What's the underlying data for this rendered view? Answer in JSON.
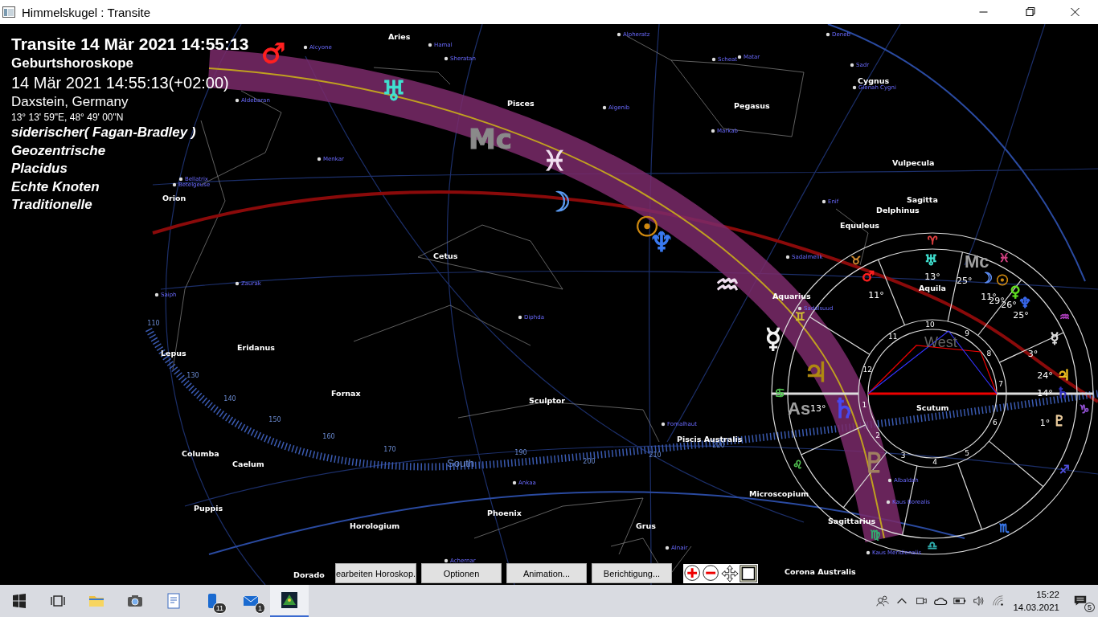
{
  "window": {
    "title": "Himmelskugel : Transite"
  },
  "info": [
    {
      "kind": "title",
      "text": "Transite 14 Mär 2021 14:55:13"
    },
    {
      "kind": "subtitle",
      "text": "Geburtshoroskope"
    },
    {
      "kind": "date",
      "text": "14 Mär 2021 14:55:13(+02:00)"
    },
    {
      "kind": "place",
      "text": "Daxstein, Germany"
    },
    {
      "kind": "coords",
      "text": "13° 13' 59\"E, 48° 49' 00\"N"
    },
    {
      "kind": "setting",
      "text": "siderischer( Fagan-Bradley )"
    },
    {
      "kind": "setting",
      "text": "Geozentrische"
    },
    {
      "kind": "setting",
      "text": "Placidus"
    },
    {
      "kind": "setting",
      "text": "Echte Knoten"
    },
    {
      "kind": "setting",
      "text": "Traditionelle"
    }
  ],
  "sky": {
    "constellations": [
      "Aries",
      "Pisces",
      "Pegasus",
      "Cygnus",
      "Vulpecula",
      "Sagitta",
      "Delphinus",
      "Equuleus",
      "Orion",
      "Cetus",
      "Aquarius",
      "Aquila",
      "Lepus",
      "Eridanus",
      "Fornax",
      "Sculptor",
      "Scutum",
      "Piscis Australis",
      "Columba",
      "Caelum",
      "Puppis",
      "Microscopium",
      "Sagittarius",
      "Phoenix",
      "Horologium",
      "Grus",
      "Dorado",
      "Corona Australis"
    ],
    "stars": [
      "Alcyone",
      "Hamal",
      "Sheratan",
      "Alpheratz",
      "Scheat",
      "Matar",
      "Deneb",
      "Sadr",
      "Gienah Cygni",
      "Aldebaran",
      "Algenib",
      "Markab",
      "Menkar",
      "Bellatrix",
      "Betelgeuse",
      "Enif",
      "Sadalmelik",
      "Zaurak",
      "Saiph",
      "Diphda",
      "Fomalhaut",
      "Ankaa",
      "Achernar",
      "Alnair",
      "Sadalsuud",
      "Albaldah",
      "Kaus Borealis",
      "Kaus Meridionalis"
    ],
    "ticks": [
      "110",
      "130",
      "140",
      "150",
      "160",
      "170",
      "190",
      "200",
      "210",
      "220"
    ],
    "direction": "South",
    "bodies": [
      {
        "glyph": "♂",
        "color": "#ff2020"
      },
      {
        "glyph": "♅",
        "color": "#40e0d0"
      },
      {
        "glyph": "Mc",
        "color": "#8a8a8a"
      },
      {
        "glyph": "♓",
        "color": "#f0e0f0"
      },
      {
        "glyph": "☽",
        "color": "#5a9af0"
      },
      {
        "glyph": "☉",
        "color": "#d08a10"
      },
      {
        "glyph": "♆",
        "color": "#3a7af0"
      },
      {
        "glyph": "♒",
        "color": "#f0e0f0"
      },
      {
        "glyph": "☿",
        "color": "#f4f4f4"
      },
      {
        "glyph": "♃",
        "color": "#b08a10"
      },
      {
        "glyph": "♄",
        "color": "#4848f0"
      },
      {
        "glyph": "♇",
        "color": "#a08060"
      }
    ]
  },
  "wheel": {
    "signs": [
      {
        "glyph": "♈",
        "color": "#e04040"
      },
      {
        "glyph": "♉",
        "color": "#d08a30"
      },
      {
        "glyph": "♊",
        "color": "#d0c030"
      },
      {
        "glyph": "♋",
        "color": "#50c050"
      },
      {
        "glyph": "♌",
        "color": "#50c050"
      },
      {
        "glyph": "♍",
        "color": "#30b070"
      },
      {
        "glyph": "♎",
        "color": "#30b0b0"
      },
      {
        "glyph": "♏",
        "color": "#3a7af0"
      },
      {
        "glyph": "♐",
        "color": "#5050e0"
      },
      {
        "glyph": "♑",
        "color": "#9050d0"
      },
      {
        "glyph": "♒",
        "color": "#b040c0"
      },
      {
        "glyph": "♓",
        "color": "#d04080"
      }
    ],
    "houses": [
      "1",
      "2",
      "3",
      "4",
      "5",
      "6",
      "7",
      "8",
      "9",
      "10",
      "11",
      "12"
    ],
    "planets": [
      {
        "glyph": "♅",
        "color": "#40e0d0",
        "degree": "13°"
      },
      {
        "glyph": "♂",
        "color": "#ff2020",
        "degree": "11°"
      },
      {
        "glyph": "☽",
        "color": "#5a8af0",
        "degree": "11°"
      },
      {
        "glyph": "☉",
        "color": "#d08a10",
        "degree": "29°"
      },
      {
        "glyph": "♀",
        "color": "#60e020",
        "degree": "26°"
      },
      {
        "glyph": "♆",
        "color": "#3a6af0",
        "degree": "25°"
      },
      {
        "glyph": "☿",
        "color": "#e0e0e0",
        "degree": "3°"
      },
      {
        "glyph": "♃",
        "color": "#f0c020",
        "degree": "24°"
      },
      {
        "glyph": "♄",
        "color": "#3030c0",
        "degree": "14°"
      },
      {
        "glyph": "♇",
        "color": "#f0d0a0",
        "degree": "1°"
      }
    ],
    "mc": {
      "label": "Mc",
      "degree": "25°"
    },
    "as": {
      "label": "As",
      "degree": "13°"
    },
    "west": "West"
  },
  "buttons": [
    "earbeiten Horoskop.",
    "Optionen",
    "Animation...",
    "Berichtigung..."
  ],
  "taskbar": {
    "badges": [
      "11",
      "1"
    ],
    "time": "15:22",
    "date": "14.03.2021",
    "notifications": "5"
  }
}
